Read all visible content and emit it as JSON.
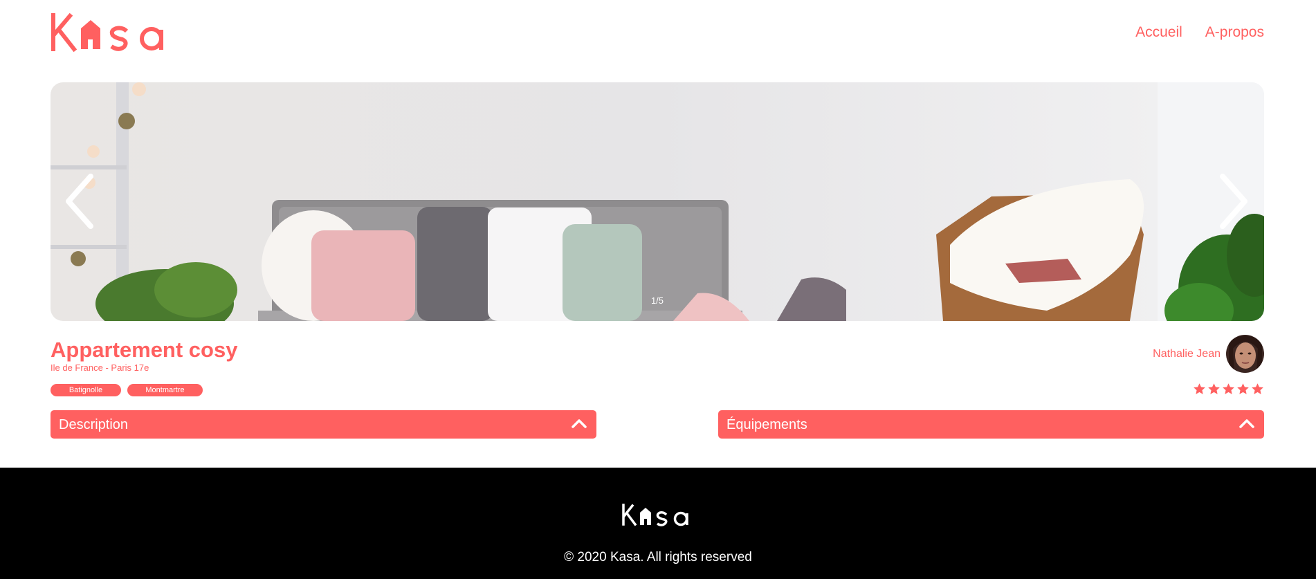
{
  "brand": {
    "name": "Kasa",
    "accent_color": "#FF6060"
  },
  "header": {
    "nav": [
      {
        "label": "Accueil"
      },
      {
        "label": "A-propos"
      }
    ]
  },
  "carousel": {
    "counter": "1/5",
    "prev_icon": "chevron-left-icon",
    "next_icon": "chevron-right-icon"
  },
  "listing": {
    "title": "Appartement cosy",
    "location": "Ile de France - Paris 17e",
    "tags": [
      "Batignolle",
      "Montmartre"
    ],
    "host_name": "Nathalie Jean",
    "rating": 5,
    "rating_max": 5
  },
  "collapses": {
    "description_label": "Description",
    "equipments_label": "Équipements",
    "chevron_icon": "chevron-up-icon"
  },
  "footer": {
    "copyright": "© 2020 Kasa. All rights reserved"
  }
}
